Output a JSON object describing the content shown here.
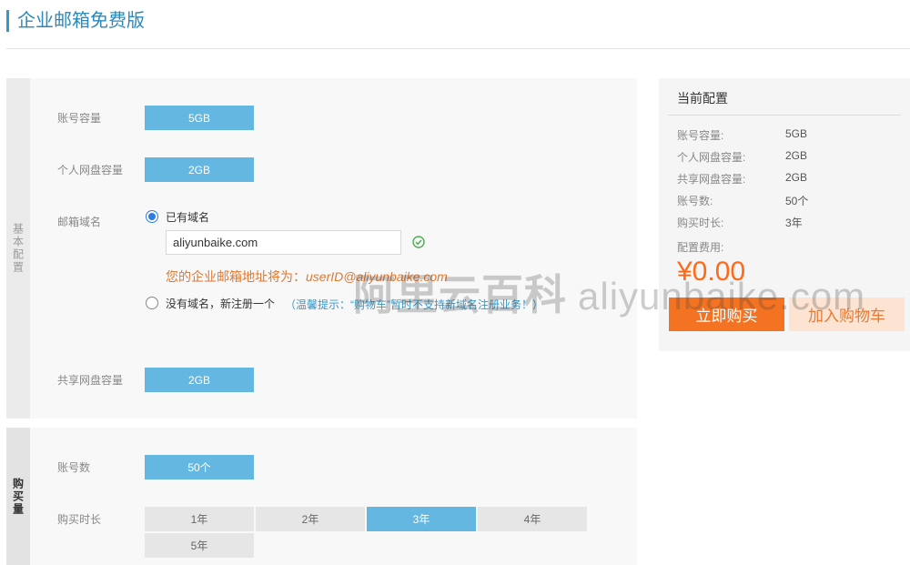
{
  "page_title": "企业邮箱免费版",
  "basic_section": {
    "tab_label": "基本配置",
    "account_capacity": {
      "label": "账号容量",
      "value": "5GB"
    },
    "personal_disk": {
      "label": "个人网盘容量",
      "value": "2GB"
    },
    "mail_domain": {
      "label": "邮箱域名",
      "option_existing": "已有域名",
      "domain_value": "aliyunbaike.com",
      "address_prefix": "您的企业邮箱地址将为：",
      "address_value": "userID@aliyunbaike.com",
      "option_new": "没有域名，新注册一个",
      "tip": "（温馨提示：“购物车”暂时不支持新域名注册业务！）"
    },
    "shared_disk": {
      "label": "共享网盘容量",
      "value": "2GB"
    }
  },
  "buy_section": {
    "tab_label": "购买量",
    "account_count": {
      "label": "账号数",
      "value": "50个"
    },
    "duration": {
      "label": "购买时长",
      "options": [
        "1年",
        "2年",
        "3年",
        "4年",
        "5年"
      ],
      "selected": "3年"
    }
  },
  "config_panel": {
    "title": "当前配置",
    "rows": [
      {
        "label": "账号容量:",
        "value": "5GB"
      },
      {
        "label": "个人网盘容量:",
        "value": "2GB"
      },
      {
        "label": "共享网盘容量:",
        "value": "2GB"
      },
      {
        "label": "账号数:",
        "value": "50个"
      },
      {
        "label": "购买时长:",
        "value": "3年"
      }
    ],
    "fee_label": "配置费用:",
    "price": "¥0.00",
    "buy_button": "立即购买",
    "cart_button": "加入购物车"
  },
  "watermark": {
    "chinese": "阿里云百科",
    "latin": "aliyunbaike.com"
  },
  "colors": {
    "accent_blue": "#63b7e0",
    "title_blue": "#2a89bd",
    "price_orange": "#ff6a1a",
    "buy_orange": "#f37322",
    "cart_bg": "#fde4d2"
  }
}
